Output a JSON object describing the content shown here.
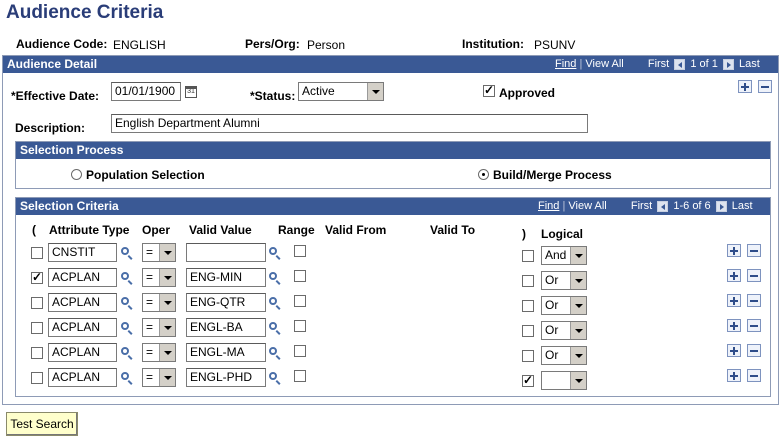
{
  "page": {
    "title": "Audience Criteria"
  },
  "header": {
    "audience_code_label": "Audience Code:",
    "audience_code_value": "ENGLISH",
    "pers_org_label": "Pers/Org:",
    "pers_org_value": "Person",
    "institution_label": "Institution:",
    "institution_value": "PSUNV"
  },
  "audience_detail": {
    "title": "Audience Detail",
    "nav": {
      "find": "Find",
      "view_all": "View All",
      "first": "First",
      "count": "1 of 1",
      "last": "Last"
    },
    "effective_date_label": "*Effective Date:",
    "effective_date_value": "01/01/1900",
    "status_label": "*Status:",
    "status_value": "Active",
    "approved_label": "Approved",
    "approved_checked": true,
    "description_label": "Description:",
    "description_value": "English Department Alumni"
  },
  "selection_process": {
    "title": "Selection Process",
    "option_population": "Population Selection",
    "option_build_merge": "Build/Merge Process",
    "selected": "build_merge"
  },
  "selection_criteria": {
    "title": "Selection Criteria",
    "nav": {
      "find": "Find",
      "view_all": "View All",
      "first": "First",
      "count": "1-6 of 6",
      "last": "Last"
    },
    "headers": {
      "open_paren": "(",
      "attribute_type": "Attribute Type",
      "oper": "Oper",
      "valid_value": "Valid Value",
      "range": "Range",
      "valid_from": "Valid From",
      "valid_to": "Valid To",
      "close_paren": ")",
      "logical": "Logical"
    },
    "rows": [
      {
        "open_paren": false,
        "attribute_type": "CNSTIT",
        "oper": "=",
        "valid_value": "",
        "range": false,
        "close_paren": false,
        "logical": "And"
      },
      {
        "open_paren": true,
        "attribute_type": "ACPLAN",
        "oper": "=",
        "valid_value": "ENG-MIN",
        "range": false,
        "close_paren": false,
        "logical": "Or"
      },
      {
        "open_paren": false,
        "attribute_type": "ACPLAN",
        "oper": "=",
        "valid_value": "ENG-QTR",
        "range": false,
        "close_paren": false,
        "logical": "Or"
      },
      {
        "open_paren": false,
        "attribute_type": "ACPLAN",
        "oper": "=",
        "valid_value": "ENGL-BA",
        "range": false,
        "close_paren": false,
        "logical": "Or"
      },
      {
        "open_paren": false,
        "attribute_type": "ACPLAN",
        "oper": "=",
        "valid_value": "ENGL-MA",
        "range": false,
        "close_paren": false,
        "logical": "Or"
      },
      {
        "open_paren": false,
        "attribute_type": "ACPLAN",
        "oper": "=",
        "valid_value": "ENGL-PHD",
        "range": false,
        "close_paren": true,
        "logical": ""
      }
    ]
  },
  "actions": {
    "test_search_label": "Test Search"
  },
  "icons": {
    "lookup": "lookup-icon",
    "calendar": "calendar-icon",
    "add": "add-row-icon",
    "delete": "delete-row-icon"
  },
  "colors": {
    "header_bar": "#3a5995",
    "title": "#2a3d78",
    "test_button": "#ffffcc"
  }
}
